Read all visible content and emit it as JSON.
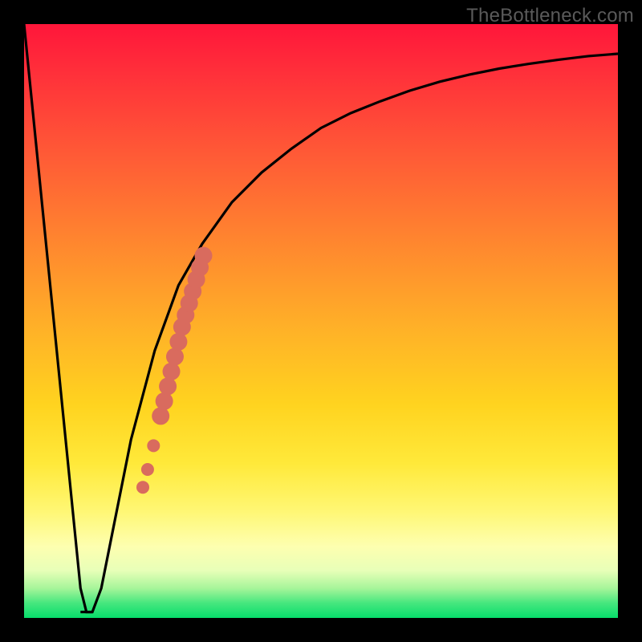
{
  "watermark": "TheBottleneck.com",
  "colors": {
    "frame": "#000000",
    "curve": "#000000",
    "dots": "#d96b5e",
    "gradient_top": "#ff163a",
    "gradient_bottom": "#07dd6b"
  },
  "chart_data": {
    "type": "line",
    "title": "",
    "xlabel": "",
    "ylabel": "",
    "xlim": [
      0,
      100
    ],
    "ylim": [
      0,
      100
    ],
    "grid": false,
    "series": [
      {
        "name": "bottleneck-curve",
        "x": [
          0,
          2,
          4,
          6,
          8,
          9.5,
          10.5,
          11.5,
          13,
          15,
          18,
          22,
          26,
          30,
          35,
          40,
          45,
          50,
          55,
          60,
          65,
          70,
          75,
          80,
          85,
          90,
          95,
          100
        ],
        "values": [
          100,
          80,
          60,
          40,
          20,
          5,
          1,
          1,
          5,
          15,
          30,
          45,
          56,
          63,
          70,
          75,
          79,
          82.5,
          85,
          87,
          88.8,
          90.3,
          91.5,
          92.5,
          93.3,
          94,
          94.6,
          95
        ]
      }
    ],
    "highlight_segment": {
      "name": "dots",
      "x": [
        20.0,
        20.8,
        21.8,
        23.0,
        23.6,
        24.2,
        24.8,
        25.4,
        26.0,
        26.6,
        27.2,
        27.8,
        28.4,
        29.0,
        29.6,
        30.2
      ],
      "values": [
        22.0,
        25.0,
        29.0,
        34.0,
        36.5,
        39.0,
        41.5,
        44.0,
        46.5,
        49.0,
        51.0,
        53.0,
        55.0,
        57.0,
        59.0,
        61.0
      ]
    },
    "notch": {
      "x_start": 9.5,
      "x_end": 11.5,
      "y": 1
    }
  }
}
